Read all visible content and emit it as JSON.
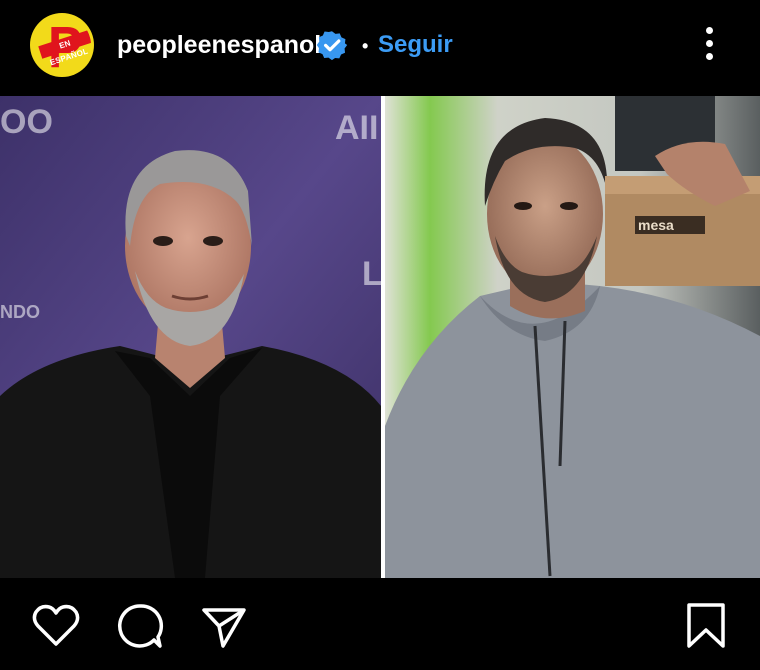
{
  "post": {
    "username": "peopleenespanol",
    "follow_label": "Seguir",
    "dot": "•",
    "avatar_band_text": "EN ESPAÑOL",
    "avatar_letter": "P",
    "verified": true
  },
  "photo": {
    "left_backdrop_text": [
      "OO",
      "AII",
      "L",
      "NDO"
    ],
    "right_box_text": "mesa"
  },
  "icons": {
    "like": "heart-icon",
    "comment": "comment-bubble-icon",
    "share": "paper-plane-icon",
    "save": "bookmark-icon",
    "more": "three-dots-vertical-icon",
    "verified": "verified-badge-icon"
  },
  "colors": {
    "background": "#000000",
    "follow": "#3c9cf5",
    "verified_badge": "#3897f0",
    "logo_yellow": "#f2da1a",
    "logo_red": "#e0141d"
  }
}
